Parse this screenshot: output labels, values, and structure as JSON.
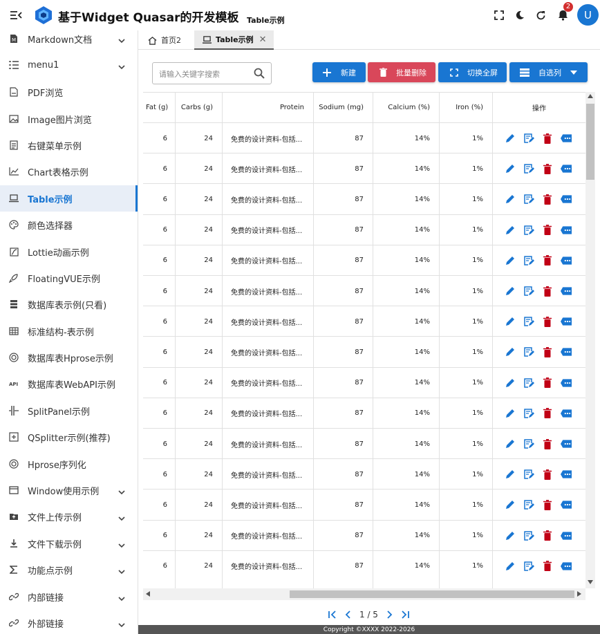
{
  "header": {
    "app_title": "基于Widget Quasar的开发模板",
    "sub_title": "Table示例",
    "notification_count": "2",
    "avatar_letter": "U"
  },
  "sidebar": {
    "items": [
      {
        "label": "Markdown文档",
        "icon": "markdown-icon",
        "expandable": true
      },
      {
        "label": "menu1",
        "icon": "list-icon",
        "expandable": true
      },
      {
        "label": "PDF浏览",
        "icon": "pdf-icon",
        "expandable": false
      },
      {
        "label": "Image图片浏览",
        "icon": "image-icon",
        "expandable": false
      },
      {
        "label": "右键菜单示例",
        "icon": "document-icon",
        "expandable": false
      },
      {
        "label": "Chart表格示例",
        "icon": "chart-icon",
        "expandable": false
      },
      {
        "label": "Table示例",
        "icon": "laptop-icon",
        "expandable": false,
        "active": true
      },
      {
        "label": "颜色选择器",
        "icon": "palette-icon",
        "expandable": false
      },
      {
        "label": "Lottie动画示例",
        "icon": "animation-icon",
        "expandable": false
      },
      {
        "label": "FloatingVUE示例",
        "icon": "rocket-icon",
        "expandable": false
      },
      {
        "label": "数据库表示例(只看)",
        "icon": "database-icon",
        "expandable": false
      },
      {
        "label": "标准结构-表示例",
        "icon": "table-icon",
        "expandable": false
      },
      {
        "label": "数据库表Hprose示例",
        "icon": "hprose-icon",
        "expandable": false
      },
      {
        "label": "数据库表WebAPI示例",
        "icon": "api-icon",
        "expandable": false
      },
      {
        "label": "SplitPanel示例",
        "icon": "split-icon",
        "expandable": false
      },
      {
        "label": "QSplitter示例(推荐)",
        "icon": "splitter-icon",
        "expandable": false
      },
      {
        "label": "Hprose序列化",
        "icon": "hprose-icon",
        "expandable": false
      },
      {
        "label": "Window使用示例",
        "icon": "window-icon",
        "expandable": true
      },
      {
        "label": "文件上传示例",
        "icon": "upload-icon",
        "expandable": true
      },
      {
        "label": "文件下载示例",
        "icon": "download-icon",
        "expandable": true
      },
      {
        "label": "功能点示例",
        "icon": "sigma-icon",
        "expandable": true
      },
      {
        "label": "内部链接",
        "icon": "link-icon",
        "expandable": true
      },
      {
        "label": "外部链接",
        "icon": "link-icon",
        "expandable": true
      }
    ]
  },
  "tabs": [
    {
      "label": "首页2",
      "icon": "home-icon"
    },
    {
      "label": "Table示例",
      "icon": "laptop-icon",
      "closable": true
    }
  ],
  "toolbar": {
    "search_placeholder": "请输入关键字搜索",
    "new_label": "新建",
    "batch_delete_label": "批量删除",
    "fullscreen_label": "切换全屏",
    "columns_label": "自选列"
  },
  "colors": {
    "primary": "#1976d2",
    "negative": "#d9475a",
    "delete_icon": "#c10015",
    "footer_bg": "#555555"
  },
  "table": {
    "columns": [
      "Fat (g)",
      "Carbs (g)",
      "Protein",
      "Sodium (mg)",
      "Calcium (%)",
      "Iron (%)",
      "操作"
    ],
    "rows": [
      [
        "6",
        "24",
        "免费的设计资料-包括...",
        "87",
        "14%",
        "1%"
      ],
      [
        "6",
        "24",
        "免费的设计资料-包括...",
        "87",
        "14%",
        "1%"
      ],
      [
        "6",
        "24",
        "免费的设计资料-包括...",
        "87",
        "14%",
        "1%"
      ],
      [
        "6",
        "24",
        "免费的设计资料-包括...",
        "87",
        "14%",
        "1%"
      ],
      [
        "6",
        "24",
        "免费的设计资料-包括...",
        "87",
        "14%",
        "1%"
      ],
      [
        "6",
        "24",
        "免费的设计资料-包括...",
        "87",
        "14%",
        "1%"
      ],
      [
        "6",
        "24",
        "免费的设计资料-包括...",
        "87",
        "14%",
        "1%"
      ],
      [
        "6",
        "24",
        "免费的设计资料-包括...",
        "87",
        "14%",
        "1%"
      ],
      [
        "6",
        "24",
        "免费的设计资料-包括...",
        "87",
        "14%",
        "1%"
      ],
      [
        "6",
        "24",
        "免费的设计资料-包括...",
        "87",
        "14%",
        "1%"
      ],
      [
        "6",
        "24",
        "免费的设计资料-包括...",
        "87",
        "14%",
        "1%"
      ],
      [
        "6",
        "24",
        "免费的设计资料-包括...",
        "87",
        "14%",
        "1%"
      ],
      [
        "6",
        "24",
        "免费的设计资料-包括...",
        "87",
        "14%",
        "1%"
      ],
      [
        "6",
        "24",
        "免费的设计资料-包括...",
        "87",
        "14%",
        "1%"
      ],
      [
        "6",
        "24",
        "免费的设计资料-包括...",
        "87",
        "14%",
        "1%"
      ]
    ]
  },
  "pagination": {
    "text": "1 / 5"
  },
  "footer": {
    "copyright": "Copyright ©XXXX 2022-2026"
  }
}
